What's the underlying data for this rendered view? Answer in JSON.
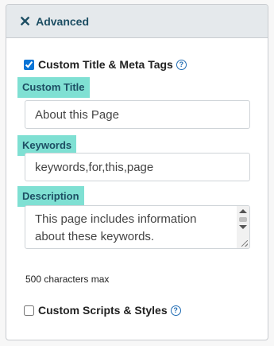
{
  "header": {
    "close_glyph": "✕",
    "title": "Advanced"
  },
  "meta_tags": {
    "checked": true,
    "label": "Custom Title & Meta Tags",
    "help_glyph": "?"
  },
  "custom_title": {
    "label": "Custom Title",
    "value": "About this Page"
  },
  "keywords": {
    "label": "Keywords",
    "value": "keywords,for,this,page"
  },
  "description": {
    "label": "Description",
    "value": "This page includes information about these keywords.",
    "hint": "500 characters max"
  },
  "scripts_styles": {
    "checked": false,
    "label": "Custom Scripts & Styles",
    "help_glyph": "?"
  },
  "colors": {
    "label_highlight": "#7fe0d3",
    "header_bg": "#e5e9ec",
    "header_text": "#1d4e63",
    "help_icon": "#1f6bb3"
  }
}
